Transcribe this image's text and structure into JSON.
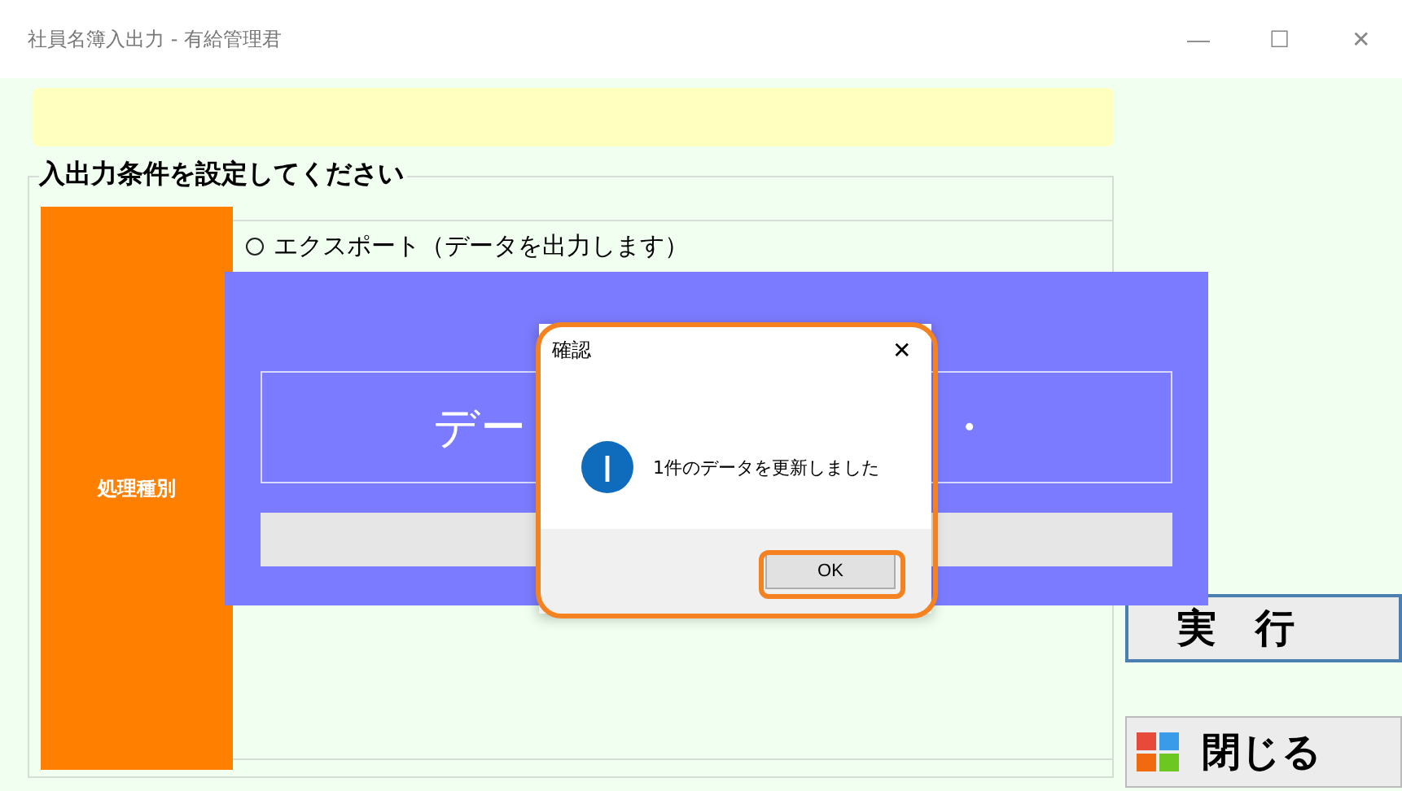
{
  "window": {
    "title": "社員名簿入出力 - 有給管理君",
    "controls": [
      "—",
      "☐",
      "✕"
    ]
  },
  "group": {
    "title": "入出力条件を設定してください",
    "row_label": "処理種別",
    "options": [
      {
        "label": "エクスポート（データを出力します）",
        "selected": false
      }
    ]
  },
  "buttons": [
    {
      "label": "実　行",
      "kind": "execute"
    },
    {
      "label": "閉じる",
      "kind": "close"
    }
  ],
  "progress": {
    "message_parts": [
      "デー",
      "・"
    ]
  },
  "dialog": {
    "title": "確認",
    "close": "✕",
    "message": "1件のデータを更新しました",
    "button": "OK"
  }
}
